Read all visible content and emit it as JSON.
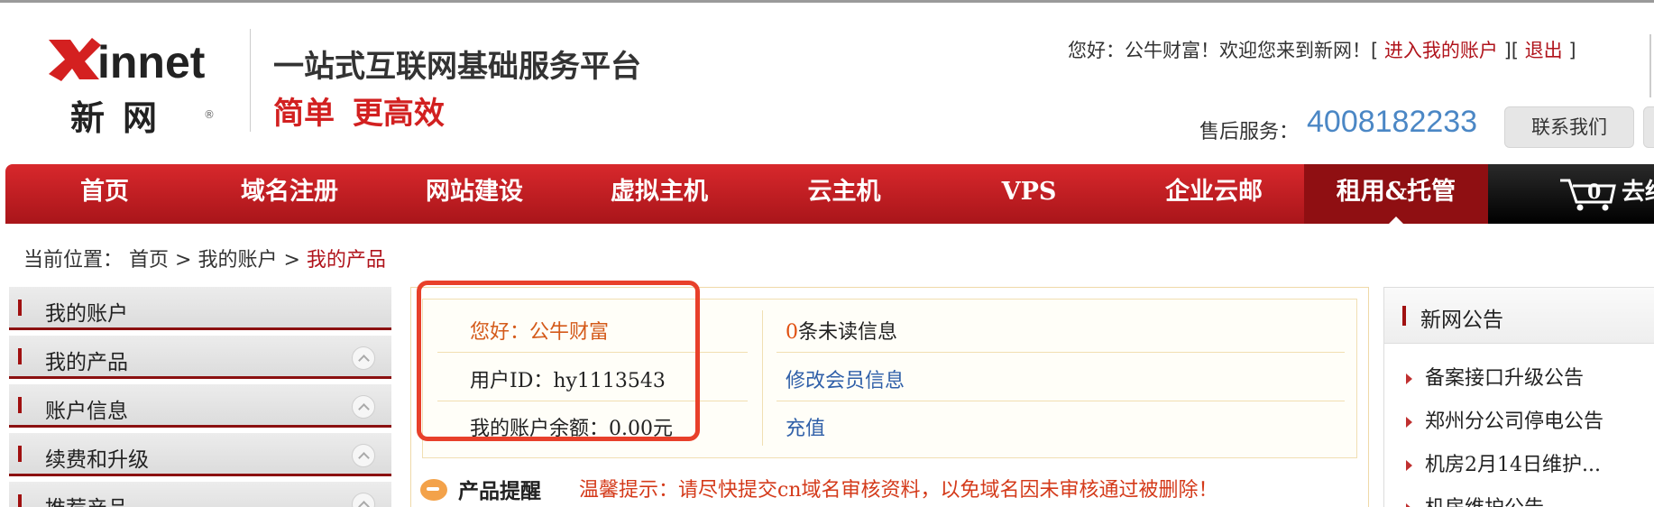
{
  "header": {
    "logo_text": "Xinnet",
    "logo_cn": "新网",
    "logo_reg": "®",
    "slogan_line1": "一站式互联网基础服务平台",
    "slogan_line2": "简单 更高效",
    "greeting_prefix": "您好：公牛财富！欢迎您来到新网！[",
    "account_link": "进入我的账户",
    "sep": "][",
    "logout_link": "退出",
    "close_bracket": "]",
    "aftersale_label": "售后服务：",
    "phone": "4008182233",
    "contact_button": "联系我们"
  },
  "nav": {
    "items": [
      "首页",
      "域名注册",
      "网站建设",
      "虚拟主机",
      "云主机",
      "VPS",
      "企业云邮",
      "租用&托管"
    ],
    "active_index": 7,
    "cart_count": "0",
    "cart_label": "去结"
  },
  "breadcrumb": {
    "prefix": "当前位置：",
    "home": "首页",
    "sep": ">",
    "account": "我的账户",
    "current": "我的产品"
  },
  "sidebar": {
    "items": [
      {
        "label": "我的账户",
        "expandable": false
      },
      {
        "label": "我的产品",
        "expandable": true
      },
      {
        "label": "账户信息",
        "expandable": true
      },
      {
        "label": "续费和升级",
        "expandable": true
      },
      {
        "label": "推荐产品",
        "expandable": true
      }
    ]
  },
  "account_info": {
    "hello": "您好：公牛财富",
    "user_id": "用户ID：hy1113543",
    "balance": "我的账户余额：0.00元",
    "unread_count": "0",
    "unread_suffix": "条未读信息",
    "edit_member": "修改会员信息",
    "recharge": "充值"
  },
  "reminder": {
    "title": "产品提醒",
    "text": "温馨提示：请尽快提交cn域名审核资料，以免域名因未审核通过被删除！"
  },
  "notice": {
    "title": "新网公告",
    "items": [
      "备案接口升级公告",
      "郑州分公司停电公告",
      "机房2月14日维护...",
      "机房维护公告"
    ]
  },
  "colors": {
    "brand_red": "#d22020",
    "nav_red": "#c21d22",
    "link_red": "#b0141c",
    "link_blue": "#2f5fa8",
    "phone_blue": "#4b87c5",
    "highlight_box": "#e8402a"
  }
}
